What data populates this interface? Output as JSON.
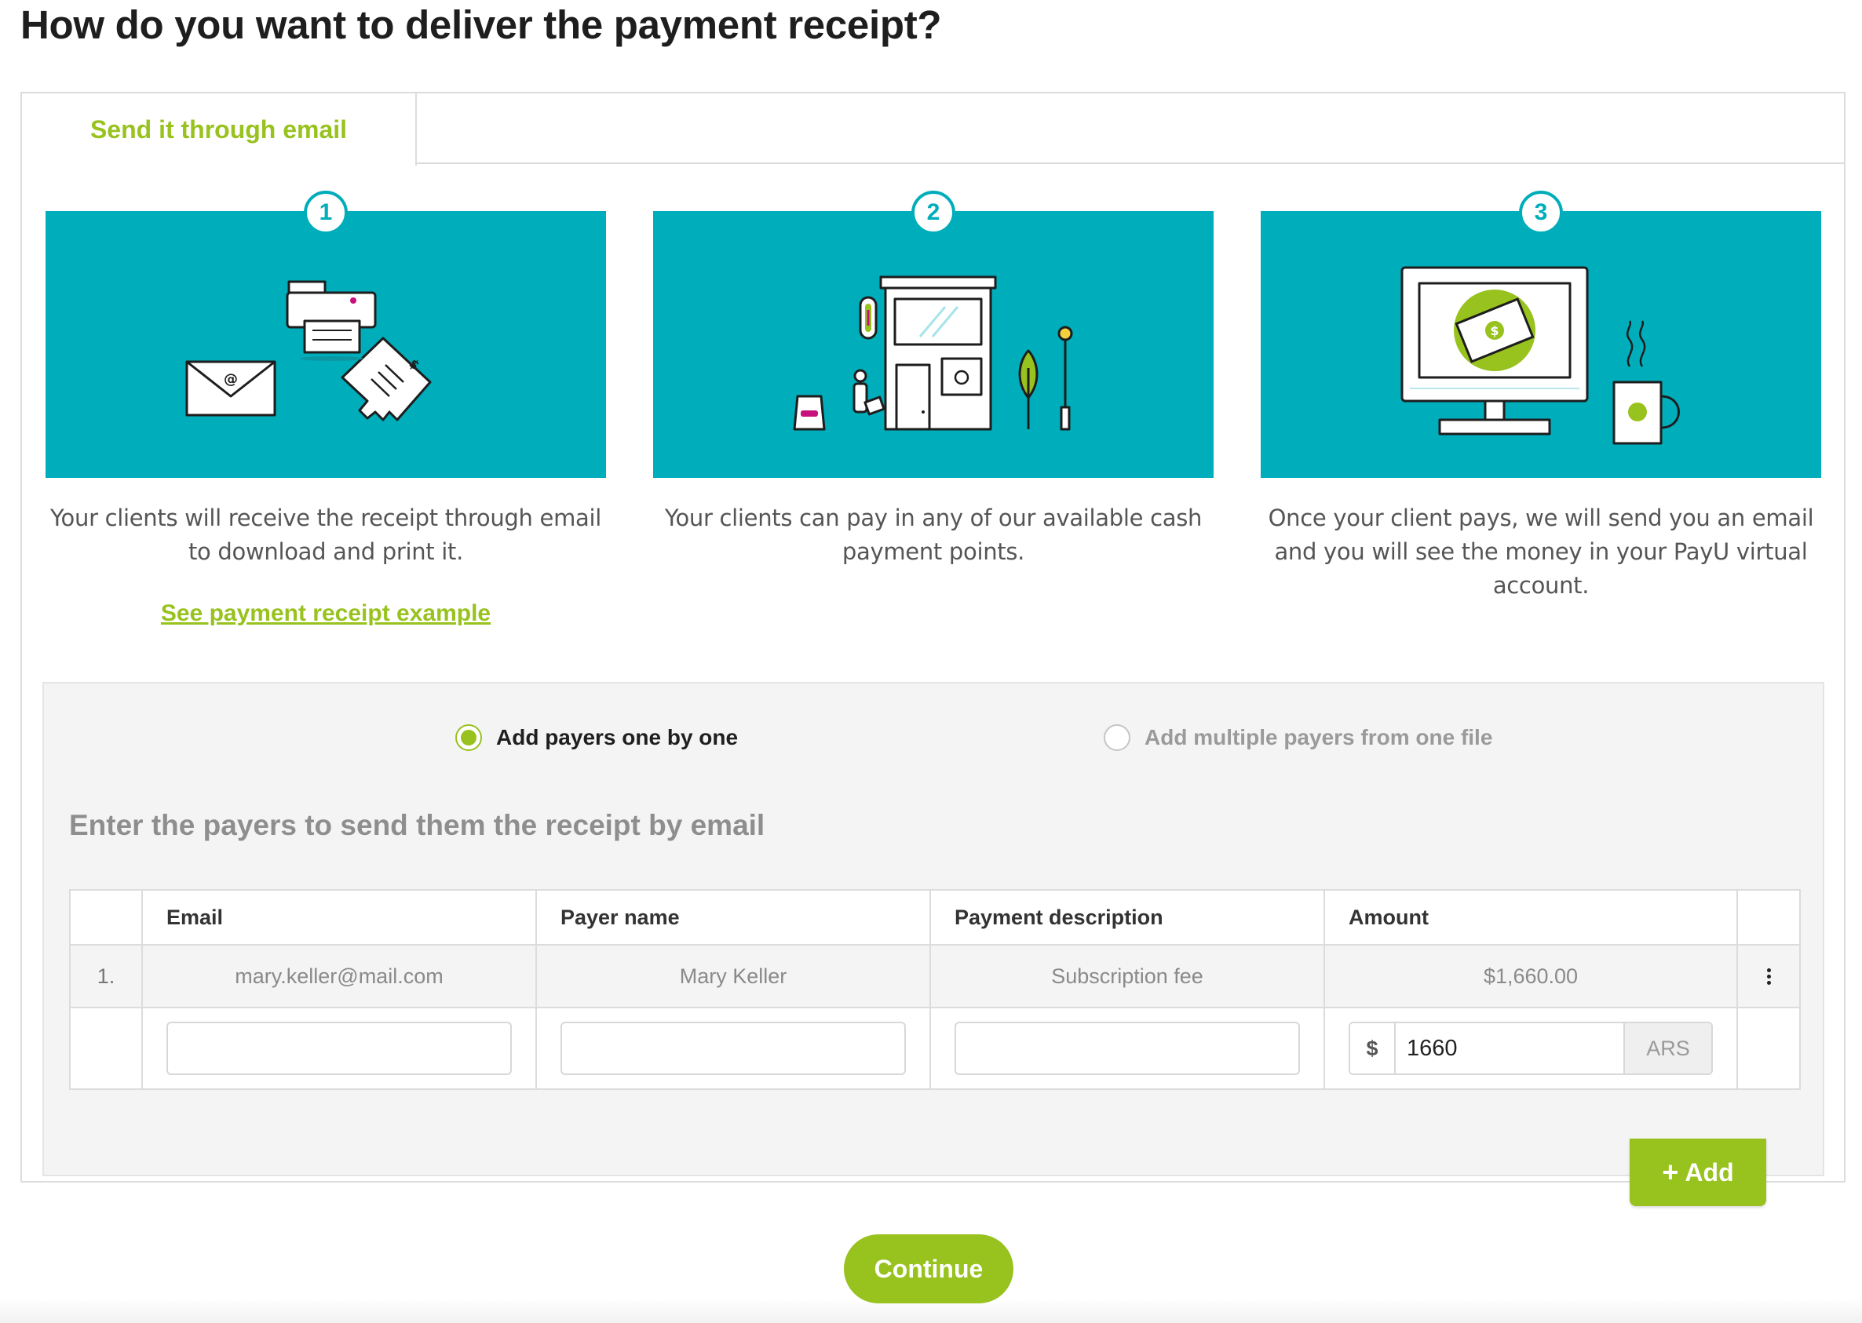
{
  "page": {
    "title": "How do you want to deliver the payment receipt?"
  },
  "tabs": [
    {
      "label": "Send it through email",
      "active": true
    }
  ],
  "steps": [
    {
      "number": "1",
      "text": "Your clients will receive the receipt through email to download and print it.",
      "link": "See payment receipt example",
      "icon": "email-printer-receipt-illustration"
    },
    {
      "number": "2",
      "text": "Your clients can pay in any of our available cash payment points.",
      "icon": "cash-payment-store-illustration"
    },
    {
      "number": "3",
      "text": "Once your client pays, we will send you an email and you will see the money in your PayU virtual account.",
      "icon": "monitor-money-coffee-illustration"
    }
  ],
  "payers": {
    "options": [
      {
        "label": "Add payers one by one",
        "selected": true
      },
      {
        "label": "Add multiple payers from one file",
        "selected": false
      }
    ],
    "section_title": "Enter the payers to send them the receipt by email",
    "columns": {
      "email": "Email",
      "name": "Payer name",
      "description": "Payment description",
      "amount": "Amount"
    },
    "rows": [
      {
        "number": "1.",
        "email": "mary.keller@mail.com",
        "name": "Mary Keller",
        "description": "Subscription fee",
        "amount": "$1,660.00"
      }
    ],
    "new_row": {
      "email": "",
      "name": "",
      "description": "",
      "currency_symbol": "$",
      "amount": "1660",
      "currency_code": "ARS"
    },
    "add_label": "Add"
  },
  "continue_label": "Continue",
  "colors": {
    "accent_green": "#98c21e",
    "teal": "#00adbb"
  }
}
